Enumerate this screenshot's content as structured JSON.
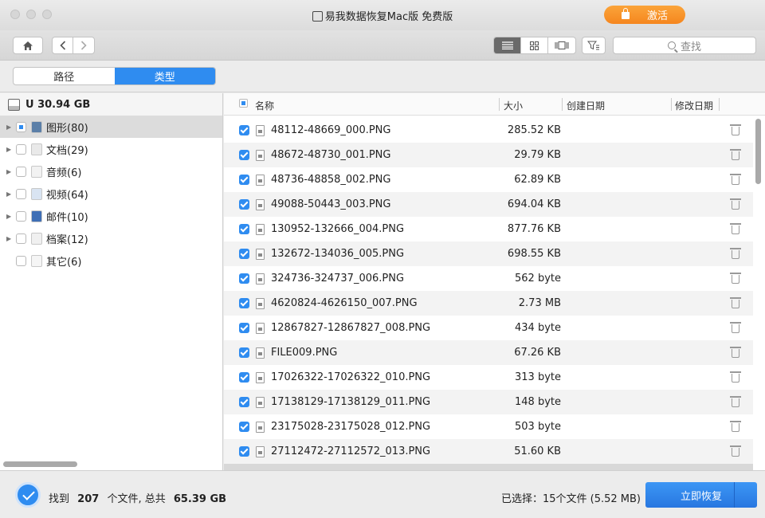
{
  "window": {
    "title": "易我数据恢复Mac版 免费版",
    "activate_label": "激活"
  },
  "toolbar": {
    "search_placeholder": "查找"
  },
  "tabs": [
    {
      "label": "路径",
      "active": false
    },
    {
      "label": "类型",
      "active": true
    }
  ],
  "sidebar": {
    "drive_label": "U 30.94 GB",
    "items": [
      {
        "label": "图形(80)",
        "icon": "image-icon",
        "selected": true
      },
      {
        "label": "文档(29)",
        "icon": "document-icon",
        "selected": false
      },
      {
        "label": "音频(6)",
        "icon": "audio-icon",
        "selected": false
      },
      {
        "label": "视频(64)",
        "icon": "video-icon",
        "selected": false
      },
      {
        "label": "邮件(10)",
        "icon": "mail-icon",
        "selected": false
      },
      {
        "label": "档案(12)",
        "icon": "archive-icon",
        "selected": false
      },
      {
        "label": "其它(6)",
        "icon": "other-icon",
        "selected": false
      }
    ]
  },
  "list": {
    "columns": [
      "名称",
      "大小",
      "创建日期",
      "修改日期"
    ],
    "rows": [
      {
        "name": "48112-48669_000.PNG",
        "size": "285.52 KB"
      },
      {
        "name": "48672-48730_001.PNG",
        "size": "29.79 KB"
      },
      {
        "name": "48736-48858_002.PNG",
        "size": "62.89 KB"
      },
      {
        "name": "49088-50443_003.PNG",
        "size": "694.04 KB"
      },
      {
        "name": "130952-132666_004.PNG",
        "size": "877.76 KB"
      },
      {
        "name": "132672-134036_005.PNG",
        "size": "698.55 KB"
      },
      {
        "name": "324736-324737_006.PNG",
        "size": "562 byte"
      },
      {
        "name": "4620824-4626150_007.PNG",
        "size": "2.73 MB"
      },
      {
        "name": "12867827-12867827_008.PNG",
        "size": "434 byte"
      },
      {
        "name": "FILE009.PNG",
        "size": "67.26 KB"
      },
      {
        "name": "17026322-17026322_010.PNG",
        "size": "313 byte"
      },
      {
        "name": "17138129-17138129_011.PNG",
        "size": "148 byte"
      },
      {
        "name": "23175028-23175028_012.PNG",
        "size": "503 byte"
      },
      {
        "name": "27112472-27112572_013.PNG",
        "size": "51.60 KB"
      }
    ]
  },
  "status": {
    "found_prefix": "找到",
    "found_count": "207",
    "found_mid": "个文件, 总共",
    "found_total": "65.39 GB",
    "selected_text": "已选择：15个文件 (5.52 MB)",
    "recover_label": "立即恢复"
  },
  "colors": {
    "accent": "#2f8cf0",
    "activate": "#f5861e"
  }
}
